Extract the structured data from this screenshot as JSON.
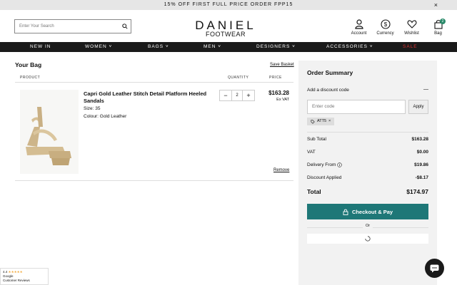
{
  "promo": {
    "text": "15% OFF FIRST FULL PRICE ORDER FPP15",
    "close": "×"
  },
  "search": {
    "placeholder": "Enter Your Search"
  },
  "logo": {
    "line1": "DANIEL",
    "line2": "FOOTWEAR"
  },
  "header_icons": {
    "account": "Account",
    "currency": "Currency",
    "wishlist": "Wishlist",
    "bag": "Bag",
    "bag_count": "2"
  },
  "nav": {
    "items": [
      "NEW IN",
      "WOMEN ˅",
      "BAGS ˅",
      "MEN ˅",
      "DESIGNERS ˅",
      "ACCESSORIES ˅",
      "SALE"
    ]
  },
  "bag": {
    "title": "Your Bag",
    "save_basket": "Save Basket",
    "columns": {
      "product": "PRODUCT",
      "quantity": "QUANTITY",
      "price": "PRICE"
    },
    "item": {
      "name": "Capri Gold Leather Stitch Detail Platform Heeled Sandals",
      "size": "Size: 35",
      "colour": "Colour: Gold Leather",
      "quantity": "2",
      "minus": "−",
      "plus": "+",
      "price": "$163.28",
      "vat_note": "Ex VAT",
      "remove": "Remove"
    }
  },
  "summary": {
    "title": "Order Summary",
    "discount_label": "Add a discount code",
    "discount_toggle": "—",
    "code_placeholder": "Enter code",
    "apply": "Apply",
    "applied_code": "ATT5",
    "applied_remove": "×",
    "rows": [
      {
        "label": "Sub Total",
        "value": "$163.28"
      },
      {
        "label": "VAT",
        "value": "$0.00"
      },
      {
        "label": "Delivery From",
        "value": "$19.86"
      },
      {
        "label": "Discount Applied",
        "value": "-$8.17"
      }
    ],
    "total_label": "Total",
    "total_value": "$174.97",
    "checkout": "Checkout & Pay",
    "or": "Or"
  },
  "reviews": {
    "rating": "4.4",
    "stars": "★★★★★",
    "line1": "Google",
    "line2": "Customer Reviews"
  },
  "colors": {
    "accent": "#1e7777",
    "nav_bg": "#1a1a1a",
    "sale": "#dd3333",
    "badge": "#2a8a6a"
  }
}
